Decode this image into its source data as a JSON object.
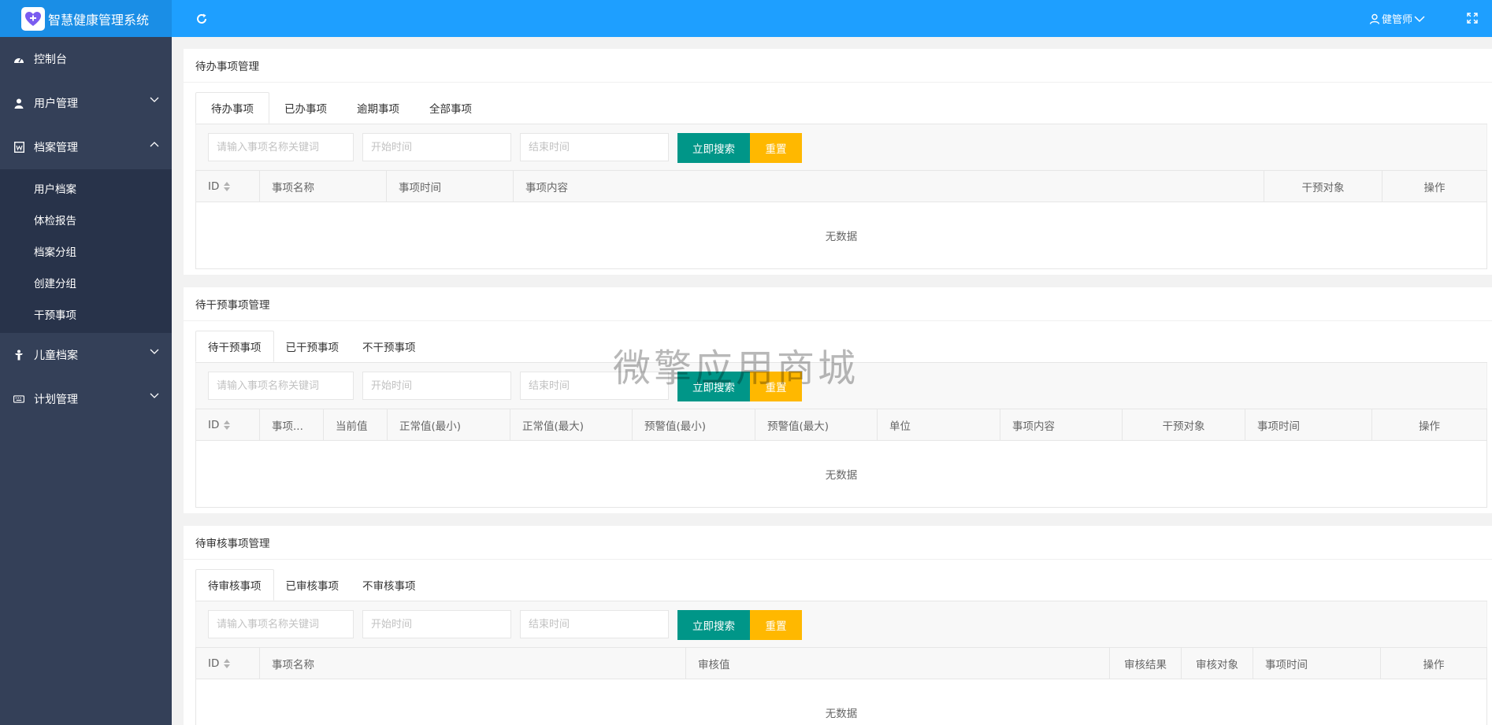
{
  "app": {
    "title": "智慧健康管理系统"
  },
  "header": {
    "user_name": "健管师"
  },
  "sidebar": {
    "items": [
      {
        "label": "控制台"
      },
      {
        "label": "用户管理"
      },
      {
        "label": "档案管理"
      },
      {
        "label": "儿童档案"
      },
      {
        "label": "计划管理"
      }
    ],
    "archive_submenu": [
      "用户档案",
      "体检报告",
      "档案分组",
      "创建分组",
      "干预事项"
    ]
  },
  "common": {
    "keyword_placeholder": "请输入事项名称关键词",
    "start_placeholder": "开始时间",
    "end_placeholder": "结束时间",
    "search_label": "立即搜索",
    "reset_label": "重置",
    "empty_text": "无数据"
  },
  "sections": [
    {
      "title": "待办事项管理",
      "tabs": [
        "待办事项",
        "已办事项",
        "逾期事项",
        "全部事项"
      ],
      "columns": [
        "ID",
        "事项名称",
        "事项时间",
        "事项内容",
        "干预对象",
        "操作"
      ]
    },
    {
      "title": "待干预事项管理",
      "tabs": [
        "待干预事项",
        "已干预事项",
        "不干预事项"
      ],
      "columns": [
        "ID",
        "事项...",
        "当前值",
        "正常值(最小)",
        "正常值(最大)",
        "预警值(最小)",
        "预警值(最大)",
        "单位",
        "事项内容",
        "干预对象",
        "事项时间",
        "操作"
      ]
    },
    {
      "title": "待审核事项管理",
      "tabs": [
        "待审核事项",
        "已审核事项",
        "不审核事项"
      ],
      "columns": [
        "ID",
        "事项名称",
        "审核值",
        "审核结果",
        "审核对象",
        "事项时间",
        "操作"
      ]
    }
  ],
  "watermark": "微擎应用商城",
  "colors": {
    "header": "#1e9fff",
    "sidebar": "#344058",
    "search_button": "#009688",
    "reset_button": "#ffb800"
  }
}
